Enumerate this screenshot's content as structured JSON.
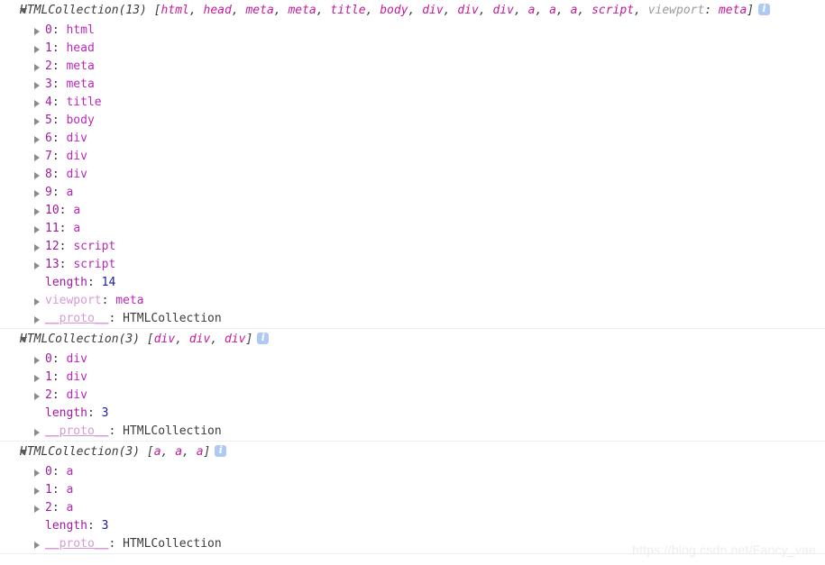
{
  "console": {
    "watermark": "https://blog.csdn.net/Fancy_vae",
    "info_icon_name": "info-icon"
  },
  "groups": [
    {
      "header": {
        "class_name": "HTMLCollection(13)",
        "open_bracket": " [",
        "preview_items": [
          "html",
          "head",
          "meta",
          "meta",
          "title",
          "body",
          "div",
          "div",
          "div",
          "a",
          "a",
          "a",
          "script"
        ],
        "preview_named_key": "viewport",
        "preview_named_value": "meta",
        "close_bracket": "]",
        "separator": ", "
      },
      "rows": [
        {
          "kind": "index",
          "arrow": true,
          "key": "0",
          "value": "html"
        },
        {
          "kind": "index",
          "arrow": true,
          "key": "1",
          "value": "head"
        },
        {
          "kind": "index",
          "arrow": true,
          "key": "2",
          "value": "meta"
        },
        {
          "kind": "index",
          "arrow": true,
          "key": "3",
          "value": "meta"
        },
        {
          "kind": "index",
          "arrow": true,
          "key": "4",
          "value": "title"
        },
        {
          "kind": "index",
          "arrow": true,
          "key": "5",
          "value": "body"
        },
        {
          "kind": "index",
          "arrow": true,
          "key": "6",
          "value": "div"
        },
        {
          "kind": "index",
          "arrow": true,
          "key": "7",
          "value": "div"
        },
        {
          "kind": "index",
          "arrow": true,
          "key": "8",
          "value": "div"
        },
        {
          "kind": "index",
          "arrow": true,
          "key": "9",
          "value": "a"
        },
        {
          "kind": "index",
          "arrow": true,
          "key": "10",
          "value": "a"
        },
        {
          "kind": "index",
          "arrow": true,
          "key": "11",
          "value": "a"
        },
        {
          "kind": "index",
          "arrow": true,
          "key": "12",
          "value": "script"
        },
        {
          "kind": "index",
          "arrow": true,
          "key": "13",
          "value": "script"
        },
        {
          "kind": "length",
          "arrow": false,
          "key": "length",
          "value": "14"
        },
        {
          "kind": "named",
          "arrow": true,
          "key": "viewport",
          "value": "meta"
        },
        {
          "kind": "proto",
          "arrow": true,
          "key": "__proto__",
          "value": "HTMLCollection"
        }
      ]
    },
    {
      "header": {
        "class_name": "HTMLCollection(3)",
        "open_bracket": " [",
        "preview_items": [
          "div",
          "div",
          "div"
        ],
        "preview_named_key": "",
        "preview_named_value": "",
        "close_bracket": "]",
        "separator": ", "
      },
      "rows": [
        {
          "kind": "index",
          "arrow": true,
          "key": "0",
          "value": "div"
        },
        {
          "kind": "index",
          "arrow": true,
          "key": "1",
          "value": "div"
        },
        {
          "kind": "index",
          "arrow": true,
          "key": "2",
          "value": "div"
        },
        {
          "kind": "length",
          "arrow": false,
          "key": "length",
          "value": "3"
        },
        {
          "kind": "proto",
          "arrow": true,
          "key": "__proto__",
          "value": "HTMLCollection"
        }
      ]
    },
    {
      "header": {
        "class_name": "HTMLCollection(3)",
        "open_bracket": " [",
        "preview_items": [
          "a",
          "a",
          "a"
        ],
        "preview_named_key": "",
        "preview_named_value": "",
        "close_bracket": "]",
        "separator": ", "
      },
      "rows": [
        {
          "kind": "index",
          "arrow": true,
          "key": "0",
          "value": "a"
        },
        {
          "kind": "index",
          "arrow": true,
          "key": "1",
          "value": "a"
        },
        {
          "kind": "index",
          "arrow": true,
          "key": "2",
          "value": "a"
        },
        {
          "kind": "length",
          "arrow": false,
          "key": "length",
          "value": "3"
        },
        {
          "kind": "proto",
          "arrow": true,
          "key": "__proto__",
          "value": "HTMLCollection"
        }
      ]
    }
  ],
  "colors": {
    "tag": "#bb28bb",
    "index": "#a019a0",
    "number": "#1a1aa6",
    "light_key": "#d69ad6",
    "text": "#3b3b3b",
    "info_badge": "#aec9f4",
    "separator_line": "#eceff1",
    "watermark": "#ededed"
  }
}
